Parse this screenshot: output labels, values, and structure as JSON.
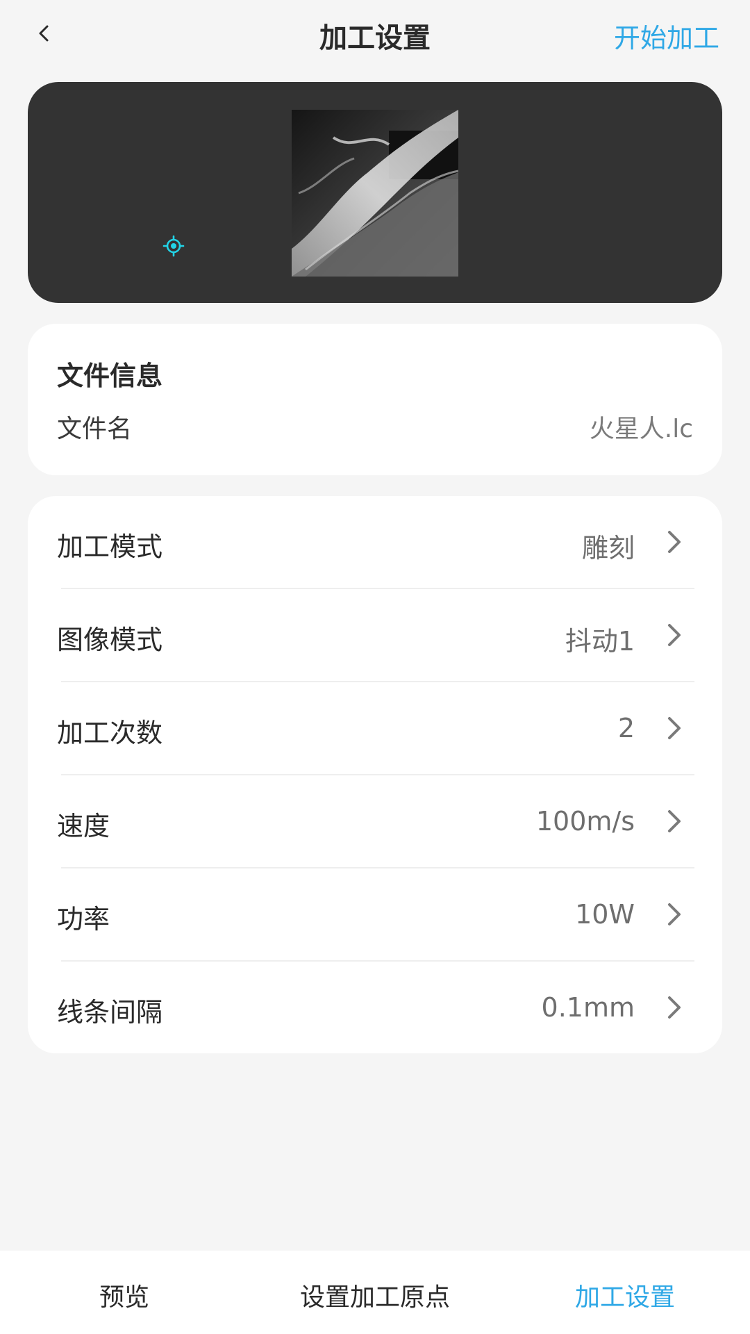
{
  "header": {
    "title": "加工设置",
    "start_label": "开始加工",
    "accent_color": "#2fa8e6"
  },
  "preview": {
    "background_color": "#333333",
    "origin_marker_color": "#22d3e6"
  },
  "file_info": {
    "title": "文件信息",
    "name_label": "文件名",
    "name_value": "火星人.lc"
  },
  "settings": [
    {
      "label": "加工模式",
      "value": "雕刻"
    },
    {
      "label": "图像模式",
      "value": "抖动1"
    },
    {
      "label": "加工次数",
      "value": "2"
    },
    {
      "label": "速度",
      "value": "100m/s"
    },
    {
      "label": "功率",
      "value": "10W"
    },
    {
      "label": "线条间隔",
      "value": "0.1mm"
    }
  ],
  "tabs": [
    {
      "label": "预览",
      "active": false
    },
    {
      "label": "设置加工原点",
      "active": false
    },
    {
      "label": "加工设置",
      "active": true
    }
  ]
}
